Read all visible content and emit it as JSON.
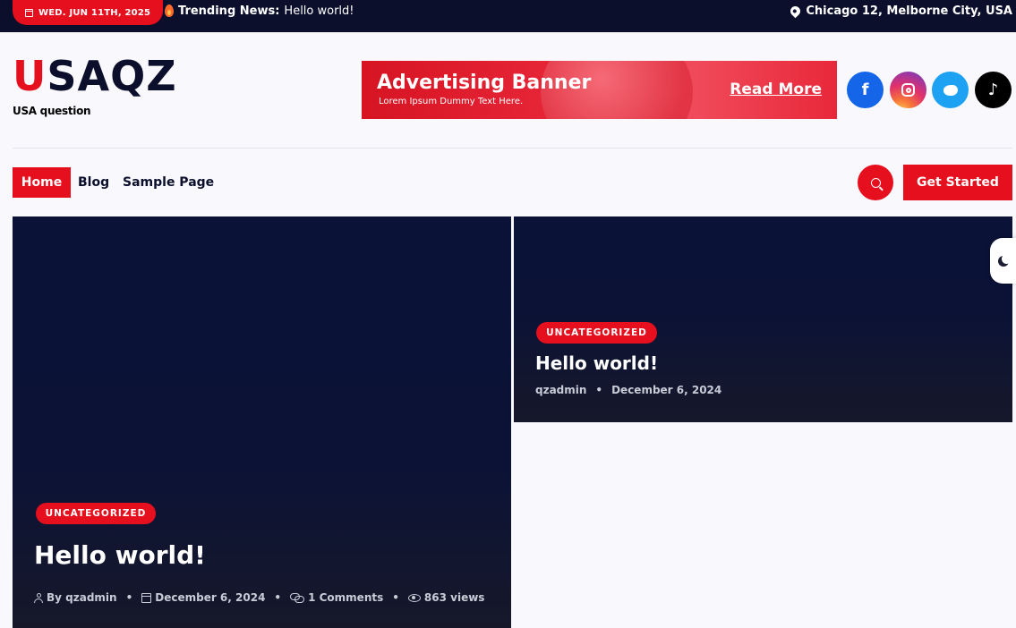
{
  "topbar": {
    "date": "WED. JUN 11TH, 2025",
    "trending_label": "Trending News:",
    "trending_text": "Hello world!",
    "location": "Chicago 12, Melborne City, USA"
  },
  "header": {
    "logo_first": "U",
    "logo_rest": "SAQZ",
    "tagline": "USA question"
  },
  "banner": {
    "title": "Advertising Banner",
    "subtitle": "Lorem Ipsum Dummy Text Here.",
    "cta": "Read More"
  },
  "social": [
    {
      "name": "facebook",
      "glyph": "f"
    },
    {
      "name": "instagram",
      "glyph": ""
    },
    {
      "name": "twitter",
      "glyph": ""
    },
    {
      "name": "tiktok",
      "glyph": "♪"
    }
  ],
  "nav": {
    "items": [
      "Home",
      "Blog",
      "Sample Page"
    ],
    "cta": "Get Started"
  },
  "posts": {
    "featured": {
      "category": "UNCATEGORIZED",
      "title": "Hello world!",
      "author": "By qzadmin",
      "date": "December 6, 2024",
      "comments": "1 Comments",
      "views": "863 views"
    },
    "side": {
      "category": "UNCATEGORIZED",
      "title": "Hello world!",
      "author": "qzadmin",
      "date": "December 6, 2024"
    }
  },
  "colors": {
    "accent": "#e50f1e",
    "dark": "#0b0f2b",
    "background": "#f8f8fd"
  }
}
